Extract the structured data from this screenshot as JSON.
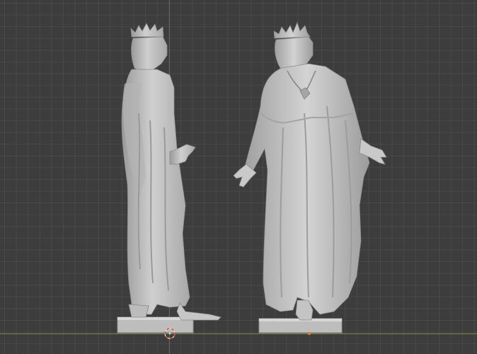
{
  "viewport": {
    "background_color": "#3d3d3d",
    "grid_color": "#4a4a4a",
    "x_axis_color": "#8a9a3c",
    "y_axis_color": "#5b6fa8",
    "model_color": "#c8c8c8"
  },
  "scene_objects": [
    {
      "name": "statue-side-view"
    },
    {
      "name": "statue-front-view"
    }
  ]
}
